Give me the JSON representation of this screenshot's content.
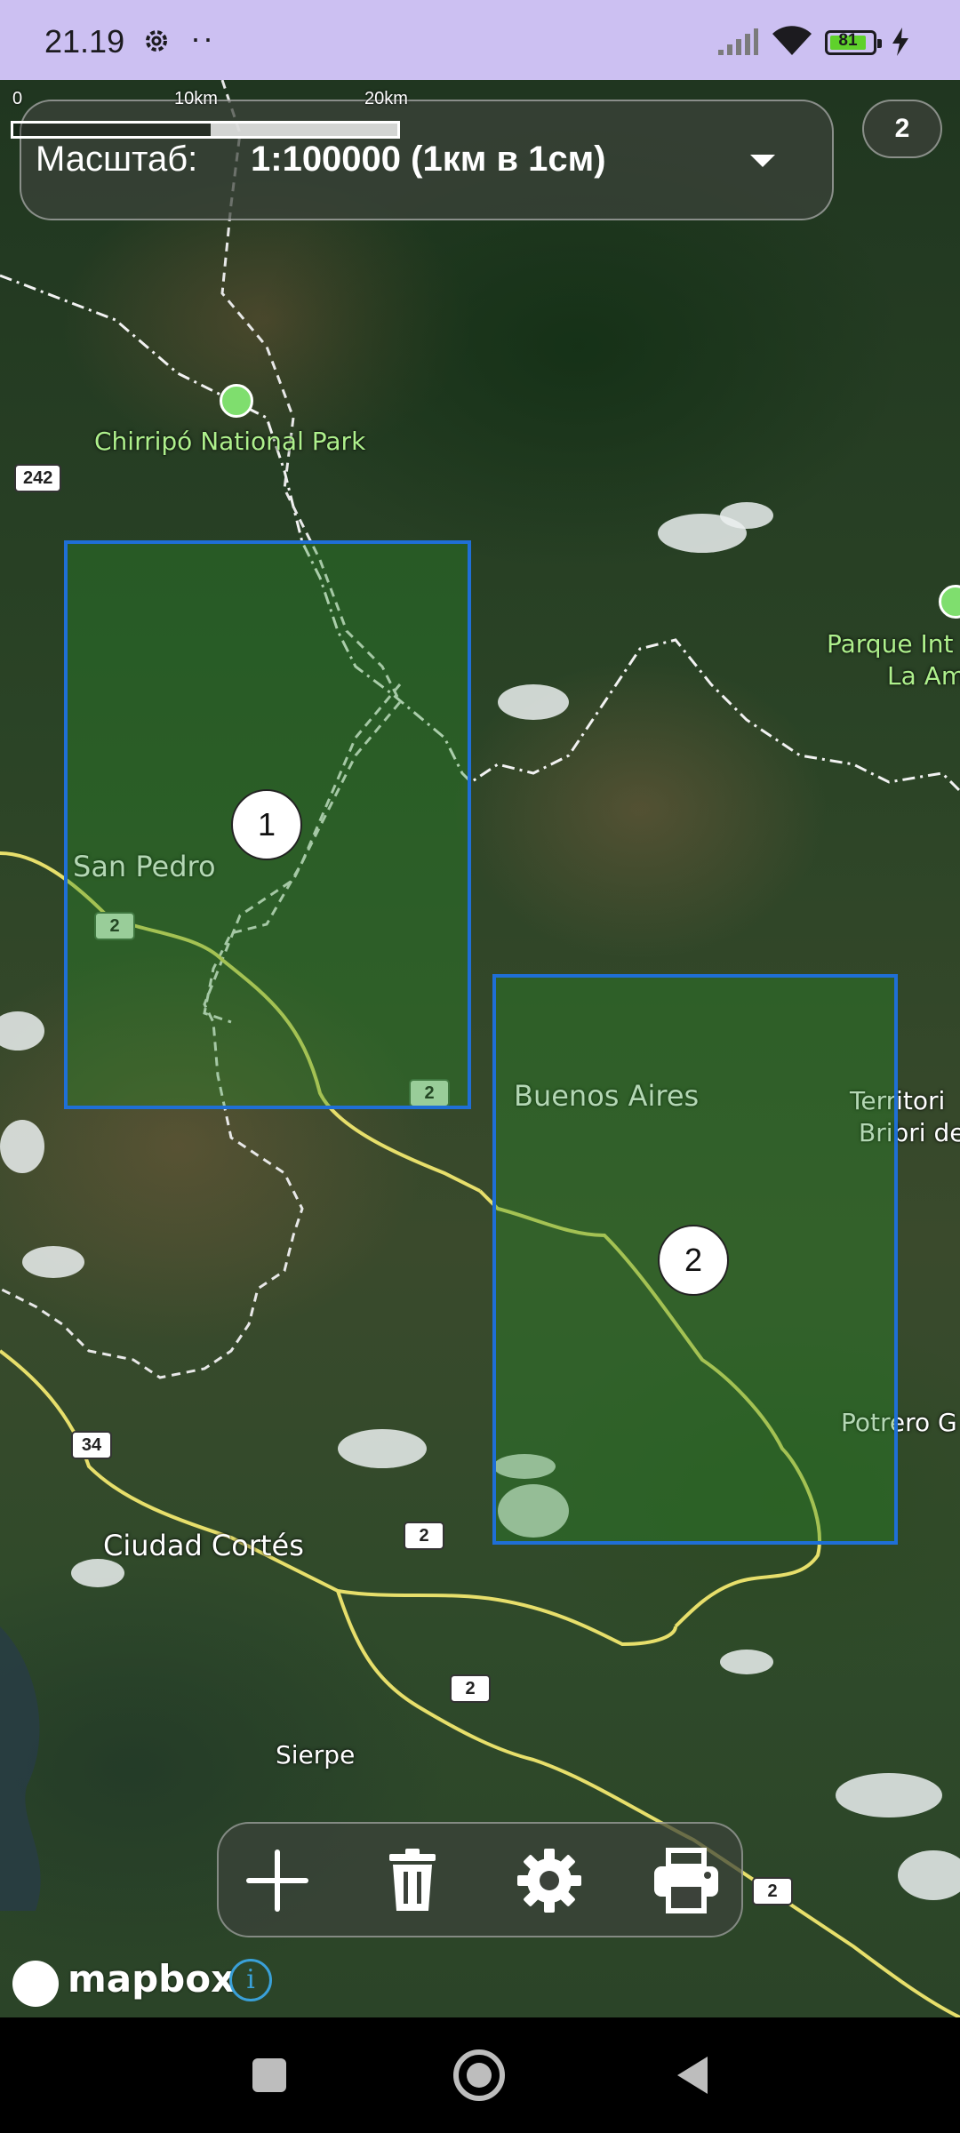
{
  "status_bar": {
    "time": "21.19",
    "dots": "··",
    "battery_level": "81",
    "battery_color": "#5fd12b",
    "background_color": "#ccc0f2",
    "icons": [
      "settings-gear-icon",
      "signal-icon",
      "wifi-icon",
      "battery-icon",
      "charging-bolt-icon"
    ]
  },
  "scale_panel": {
    "label": "Масштаб:",
    "value": "1:100000 (1км в 1см)",
    "dropdown_icon": "caret-down-icon"
  },
  "scale_bar": {
    "ticks": [
      "0",
      "10km",
      "20km"
    ]
  },
  "count_badge": "2",
  "map": {
    "region_color": "#1f6fd6",
    "park_label_color": "#aef08c",
    "road_color": "#e7df6b",
    "labels": {
      "park": "Chirripó National Park",
      "park2_line1": "Parque Int",
      "park2_line2": "La Am",
      "san_pedro": "San Pedro",
      "buenos_aires": "Buenos Aires",
      "territory_line1": "Territori",
      "territory_line2": "Bribri de",
      "potrero": "Potrero G",
      "ciudad_cortes": "Ciudad Cortés",
      "sierpe": "Sierpe"
    },
    "road_shields": [
      "242",
      "2",
      "2",
      "34",
      "2",
      "2",
      "2"
    ],
    "regions": [
      {
        "number": "1"
      },
      {
        "number": "2"
      }
    ]
  },
  "toolbar": {
    "buttons": [
      {
        "name": "add",
        "icon": "plus-icon"
      },
      {
        "name": "delete",
        "icon": "trash-icon"
      },
      {
        "name": "settings",
        "icon": "gear-icon"
      },
      {
        "name": "print",
        "icon": "printer-icon"
      }
    ]
  },
  "attribution": {
    "logo_text": "mapbox",
    "info_symbol": "i"
  },
  "nav_bar": {
    "icons": [
      "recent-apps-icon",
      "home-icon",
      "back-icon"
    ]
  }
}
